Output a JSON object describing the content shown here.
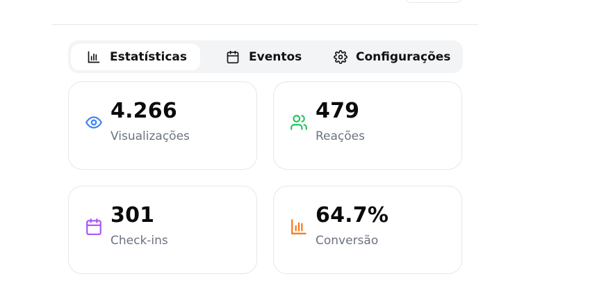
{
  "tabs": [
    {
      "label": "Estatísticas",
      "icon": "bar-chart-icon",
      "active": true
    },
    {
      "label": "Eventos",
      "icon": "calendar-icon",
      "active": false
    },
    {
      "label": "Configurações",
      "icon": "gear-icon",
      "active": false
    }
  ],
  "stats": [
    {
      "value": "4.266",
      "label": "Visualizações",
      "icon": "eye-icon",
      "color": "#3b82f6"
    },
    {
      "value": "479",
      "label": "Reações",
      "icon": "users-icon",
      "color": "#22c55e"
    },
    {
      "value": "301",
      "label": "Check-ins",
      "icon": "calendar-icon",
      "color": "#a855f7"
    },
    {
      "value": "64.7%",
      "label": "Conversão",
      "icon": "bar-chart-icon",
      "color": "#f97316"
    }
  ]
}
